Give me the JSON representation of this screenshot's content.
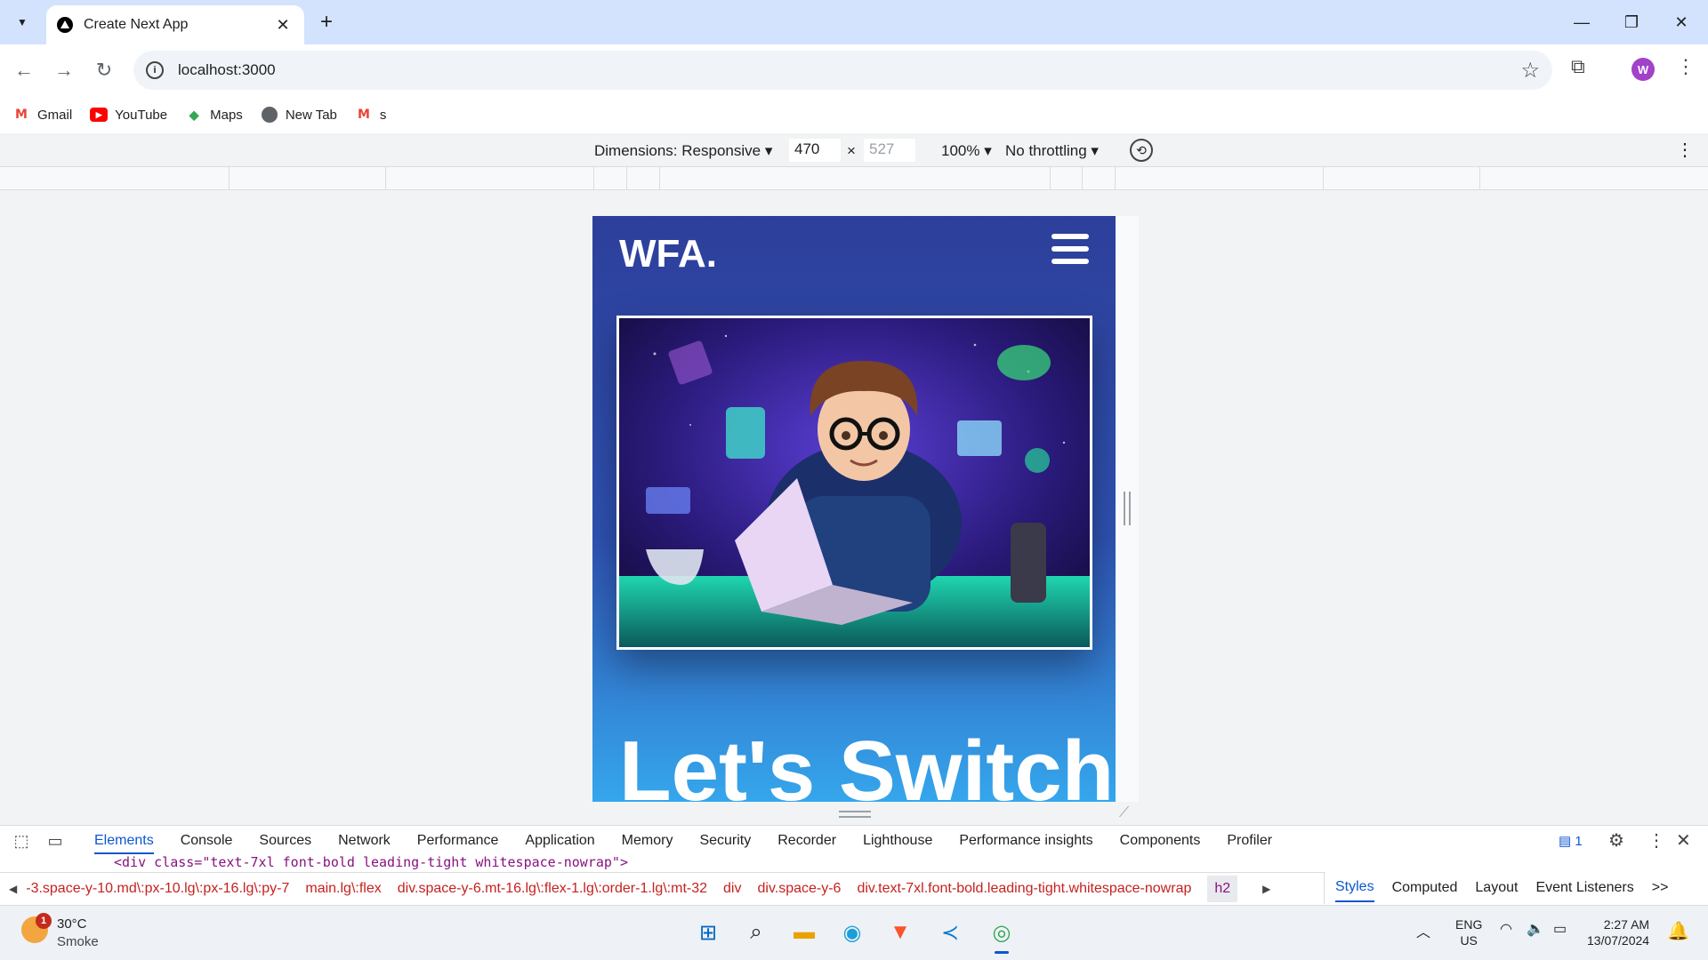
{
  "browser": {
    "tab_title": "Create Next App",
    "url": "localhost:3000",
    "avatar_letter": "W",
    "bookmarks": [
      {
        "label": "Gmail",
        "icon": "gmail-icon"
      },
      {
        "label": "YouTube",
        "icon": "youtube-icon"
      },
      {
        "label": "Maps",
        "icon": "maps-icon"
      },
      {
        "label": "New Tab",
        "icon": "globe-icon"
      },
      {
        "label": "s",
        "icon": "gmail-icon"
      }
    ]
  },
  "device_toolbar": {
    "dimensions_label": "Dimensions: Responsive",
    "width_value": "470",
    "times": "×",
    "height_value": "527",
    "zoom": "100%",
    "throttling": "No throttling"
  },
  "page": {
    "logo": "WFA.",
    "hero_title": "Let's Switch"
  },
  "devtools": {
    "tabs": [
      "Elements",
      "Console",
      "Sources",
      "Network",
      "Performance",
      "Application",
      "Memory",
      "Security",
      "Recorder",
      "Lighthouse",
      "Performance insights",
      "Components",
      "Profiler"
    ],
    "active_tab": "Elements",
    "issues_count": "1",
    "code_line": "<div class=\"text-7xl font-bold leading-tight whitespace-nowrap\">",
    "breadcrumbs": [
      "-3.space-y-10.md\\:px-10.lg\\:px-16.lg\\:py-7",
      "main.lg\\:flex",
      "div.space-y-6.mt-16.lg\\:flex-1.lg\\:order-1.lg\\:mt-32",
      "div",
      "div.space-y-6",
      "div.text-7xl.font-bold.leading-tight.whitespace-nowrap",
      "h2"
    ],
    "side_tabs": [
      "Styles",
      "Computed",
      "Layout",
      "Event Listeners"
    ],
    "side_more": ">>"
  },
  "taskbar": {
    "weather_temp": "30°C",
    "weather_desc": "Smoke",
    "weather_badge": "1",
    "lang_top": "ENG",
    "lang_bottom": "US",
    "time": "2:27 AM",
    "date": "13/07/2024"
  },
  "colors": {
    "hero_gradient_top": "#2d3f9a",
    "hero_gradient_bottom": "#35a6ec",
    "devtools_accent": "#0b57d0"
  }
}
